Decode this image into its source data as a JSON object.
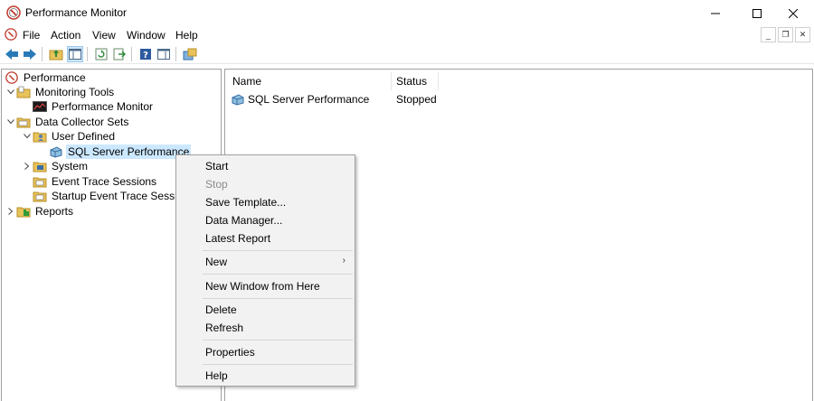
{
  "window": {
    "title": "Performance Monitor"
  },
  "menubar": {
    "items": [
      "File",
      "Action",
      "View",
      "Window",
      "Help"
    ]
  },
  "tree": {
    "root": "Performance",
    "monitoring_tools": "Monitoring Tools",
    "performance_monitor": "Performance Monitor",
    "data_collector_sets": "Data Collector Sets",
    "user_defined": "User Defined",
    "sql_server_performance": "SQL Server Performance",
    "system": "System",
    "event_trace_sessions": "Event Trace Sessions",
    "startup_event_trace_sessions": "Startup Event Trace Sessions",
    "reports": "Reports"
  },
  "list": {
    "columns": [
      "Name",
      "Status"
    ],
    "rows": [
      {
        "name": "SQL Server Performance",
        "status": "Stopped"
      }
    ]
  },
  "context_menu": {
    "start": "Start",
    "stop": "Stop",
    "save_template": "Save Template...",
    "data_manager": "Data Manager...",
    "latest_report": "Latest Report",
    "new": "New",
    "new_window": "New Window from Here",
    "delete": "Delete",
    "refresh": "Refresh",
    "properties": "Properties",
    "help": "Help"
  },
  "colors": {
    "selection": "#cce8ff",
    "menu_bg": "#f2f2f2",
    "pressed": "#cce4f7"
  }
}
